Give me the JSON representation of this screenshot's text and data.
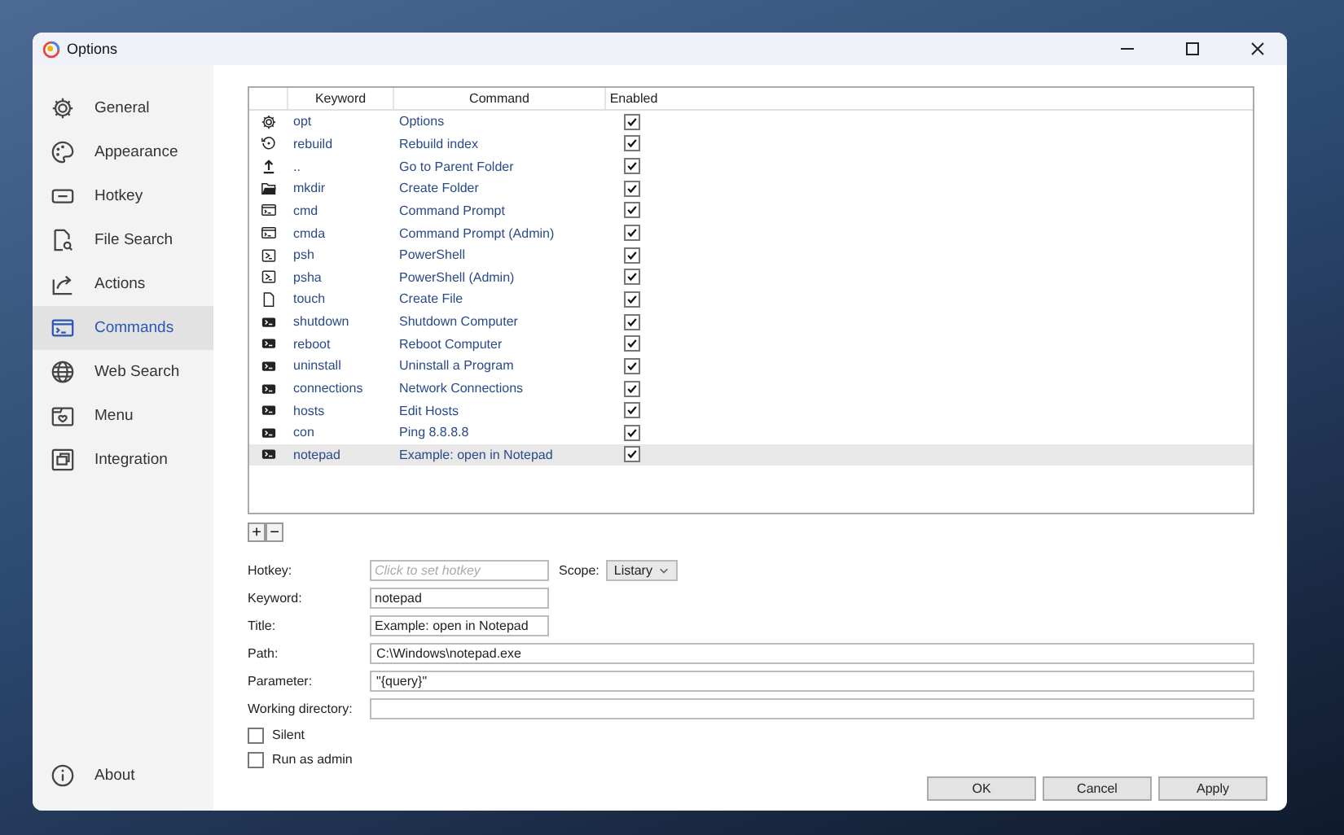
{
  "window": {
    "title": "Options"
  },
  "sidebar": {
    "items": [
      {
        "label": "General",
        "kind": "gear",
        "selected": false
      },
      {
        "label": "Appearance",
        "kind": "palette",
        "selected": false
      },
      {
        "label": "Hotkey",
        "kind": "keyboard",
        "selected": false
      },
      {
        "label": "File Search",
        "kind": "file-search",
        "selected": false
      },
      {
        "label": "Actions",
        "kind": "share",
        "selected": false
      },
      {
        "label": "Commands",
        "kind": "terminal",
        "selected": true
      },
      {
        "label": "Web Search",
        "kind": "globe",
        "selected": false
      },
      {
        "label": "Menu",
        "kind": "menu",
        "selected": false
      },
      {
        "label": "Integration",
        "kind": "windows",
        "selected": false
      }
    ],
    "footer": {
      "label": "About",
      "kind": "info"
    }
  },
  "table": {
    "columns": [
      "Keyword",
      "Command",
      "Enabled"
    ],
    "rows": [
      {
        "kind": "gear",
        "keyword": "opt",
        "command": "Options",
        "enabled": true,
        "selected": false
      },
      {
        "kind": "history",
        "keyword": "rebuild",
        "command": "Rebuild index",
        "enabled": true,
        "selected": false
      },
      {
        "kind": "up",
        "keyword": "..",
        "command": "Go to Parent Folder",
        "enabled": true,
        "selected": false
      },
      {
        "kind": "folder",
        "keyword": "mkdir",
        "command": "Create Folder",
        "enabled": true,
        "selected": false
      },
      {
        "kind": "terminal",
        "keyword": "cmd",
        "command": "Command Prompt",
        "enabled": true,
        "selected": false
      },
      {
        "kind": "terminal",
        "keyword": "cmda",
        "command": "Command Prompt (Admin)",
        "enabled": true,
        "selected": false
      },
      {
        "kind": "powershell",
        "keyword": "psh",
        "command": "PowerShell",
        "enabled": true,
        "selected": false
      },
      {
        "kind": "powershell",
        "keyword": "psha",
        "command": "PowerShell (Admin)",
        "enabled": true,
        "selected": false
      },
      {
        "kind": "file",
        "keyword": "touch",
        "command": "Create File",
        "enabled": true,
        "selected": false
      },
      {
        "kind": "script",
        "keyword": "shutdown",
        "command": "Shutdown Computer",
        "enabled": true,
        "selected": false
      },
      {
        "kind": "script",
        "keyword": "reboot",
        "command": "Reboot Computer",
        "enabled": true,
        "selected": false
      },
      {
        "kind": "script",
        "keyword": "uninstall",
        "command": "Uninstall a Program",
        "enabled": true,
        "selected": false
      },
      {
        "kind": "script",
        "keyword": "connections",
        "command": "Network Connections",
        "enabled": true,
        "selected": false
      },
      {
        "kind": "script",
        "keyword": "hosts",
        "command": "Edit Hosts",
        "enabled": true,
        "selected": false
      },
      {
        "kind": "script",
        "keyword": "con",
        "command": "Ping 8.8.8.8",
        "enabled": true,
        "selected": false
      },
      {
        "kind": "script",
        "keyword": "notepad",
        "command": "Example: open in Notepad",
        "enabled": true,
        "selected": true
      }
    ]
  },
  "toolbar": {
    "add": "+",
    "remove": "−"
  },
  "form": {
    "hotkey": {
      "label": "Hotkey:",
      "placeholder": "Click to set hotkey"
    },
    "scope": {
      "label": "Scope:",
      "value": "Listary"
    },
    "fields": [
      {
        "label": "Keyword:",
        "value": "notepad",
        "kind": "short"
      },
      {
        "label": "Title:",
        "value": "Example: open in Notepad",
        "kind": "short"
      },
      {
        "label": "Path:",
        "value": "C:\\Windows\\notepad.exe",
        "kind": "wide"
      },
      {
        "label": "Parameter:",
        "value": "\"{query}\"",
        "kind": "wide"
      },
      {
        "label": "Working directory:",
        "kind": "wide"
      }
    ],
    "options": [
      {
        "label": "Silent",
        "checked": false
      },
      {
        "label": "Run as admin",
        "checked": false
      }
    ]
  },
  "buttons": [
    "OK",
    "Cancel",
    "Apply"
  ]
}
